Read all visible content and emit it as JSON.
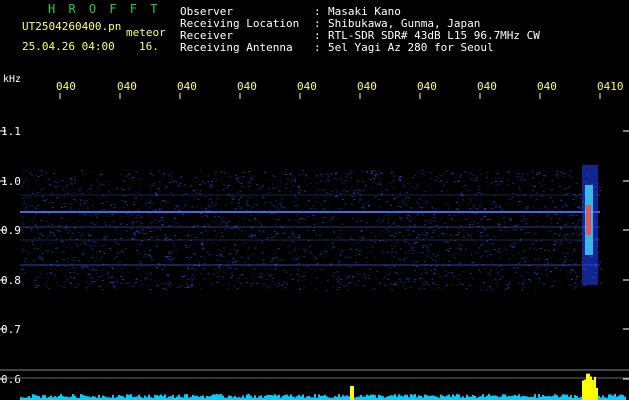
{
  "header": {
    "title": "H R O F F T",
    "file": "UT2504260400.pn",
    "tag": "meteor",
    "datetime": "25.04.26 04:00",
    "count": "16."
  },
  "info": [
    {
      "label": "Observer",
      "value": "Masaki Kano"
    },
    {
      "label": "Receiving Location",
      "value": "Shibukawa, Gunma, Japan"
    },
    {
      "label": "Receiver",
      "value": "RTL-SDR SDR# 43dB L15 96.7MHz CW"
    },
    {
      "label": "Receiving Antenna",
      "value": "5el Yagi Az 280 for Seoul"
    }
  ],
  "colon": ":",
  "axis": {
    "unit": "kHz",
    "time_ticks": [
      "040",
      "040",
      "040",
      "040",
      "040",
      "040",
      "040",
      "040",
      "040",
      "0410"
    ],
    "freq_ticks": [
      "1.1",
      "1.0",
      "0.9",
      "0.8",
      "0.7",
      "0.6"
    ]
  },
  "colors": {
    "background": "#000000",
    "signal": "#3355ff",
    "header_text": "#ffff66",
    "title_text": "#22cc44",
    "meteor_echo": "#ff4444",
    "level_meter": "#00ccff",
    "level_peak": "#ffff00"
  }
}
